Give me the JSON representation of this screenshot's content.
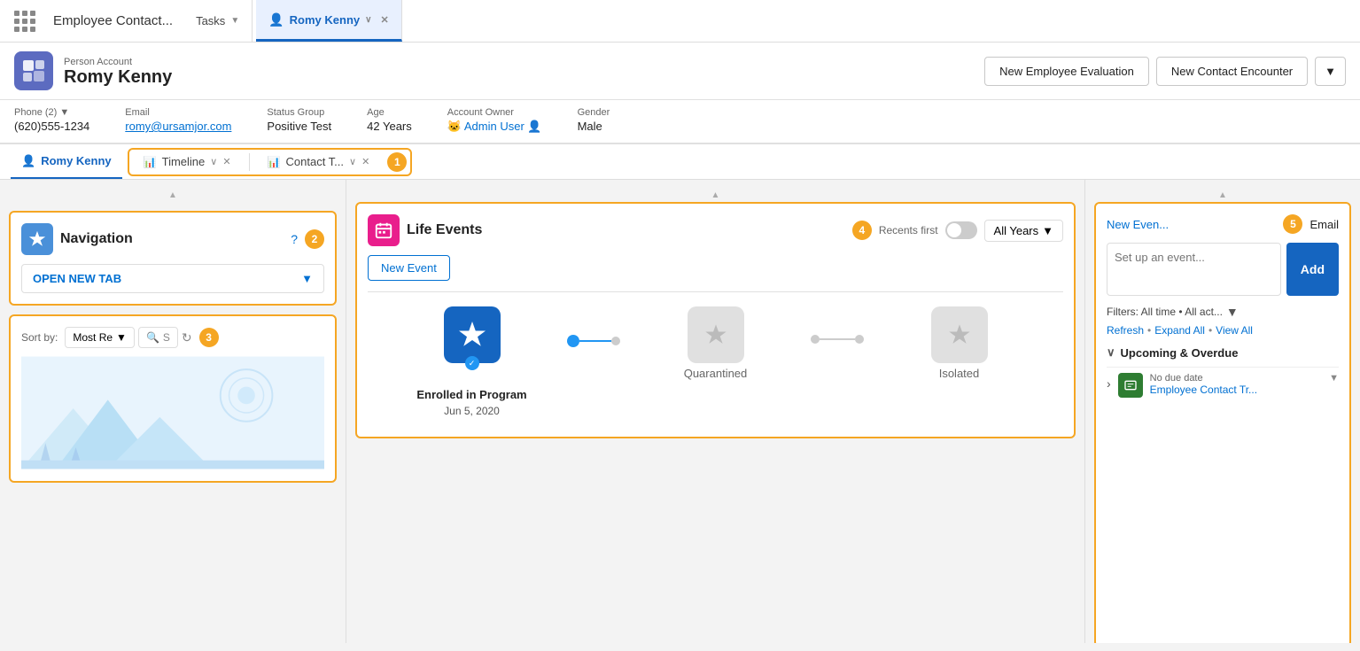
{
  "app": {
    "grid_icon": "⠿",
    "title": "Employee Contact...",
    "tabs": [
      {
        "id": "tasks",
        "label": "Tasks",
        "icon": "",
        "active": false
      },
      {
        "id": "romy-kenny",
        "label": "Romy Kenny",
        "icon": "👤",
        "active": true
      }
    ]
  },
  "header": {
    "record_type": "Person Account",
    "name": "Romy Kenny",
    "buttons": {
      "new_employee_eval": "New Employee Evaluation",
      "new_contact_encounter": "New Contact Encounter",
      "dropdown": "▼"
    }
  },
  "info_bar": {
    "phone_label": "Phone (2) ▼",
    "phone_value": "(620)555-1234",
    "email_label": "Email",
    "email_value": "romy@ursamjor.com",
    "status_group_label": "Status Group",
    "status_group_value": "Positive Test",
    "age_label": "Age",
    "age_value": "42 Years",
    "account_owner_label": "Account Owner",
    "account_owner_value": "Admin User",
    "gender_label": "Gender",
    "gender_value": "Male"
  },
  "sub_nav": {
    "tabs": [
      {
        "id": "romy-kenny",
        "label": "Romy Kenny",
        "icon": "👤",
        "active": true
      },
      {
        "id": "timeline",
        "label": "Timeline",
        "icon": "📊",
        "active": false
      },
      {
        "id": "contact-t",
        "label": "Contact T...",
        "icon": "📊",
        "active": false
      }
    ],
    "badge_1": "1"
  },
  "navigation_panel": {
    "title": "Navigation",
    "badge": "2",
    "question_mark": "?",
    "open_new_tab": "OPEN NEW TAB"
  },
  "sort_panel": {
    "sort_label": "Sort by:",
    "sort_value": "Most Re",
    "search_placeholder": "S",
    "badge": "3"
  },
  "life_events": {
    "title": "Life Events",
    "badge": "4",
    "recents_label": "Recents first",
    "all_years": "All Years",
    "new_event_btn": "New Event",
    "events": [
      {
        "id": "enrolled",
        "label": "Enrolled in Program",
        "date": "Jun 5, 2020",
        "active": true,
        "checked": true
      },
      {
        "id": "quarantined",
        "label": "Quarantined",
        "date": "",
        "active": false,
        "checked": false
      },
      {
        "id": "isolated",
        "label": "Isolated",
        "date": "",
        "active": false,
        "checked": false
      }
    ]
  },
  "right_panel": {
    "badge": "5",
    "new_event_link": "New Even...",
    "email_label": "Email",
    "event_placeholder": "Set up an event...",
    "add_btn": "Add",
    "filters_text": "Filters: All time • All act...",
    "filter_icon": "▼",
    "refresh_link": "Refresh",
    "expand_link": "Expand All",
    "view_link": "View All",
    "upcoming_label": "Upcoming & Overdue",
    "task_due": "No due date",
    "task_title": "Employee Contact Tr...",
    "task_dropdown": "▼"
  }
}
